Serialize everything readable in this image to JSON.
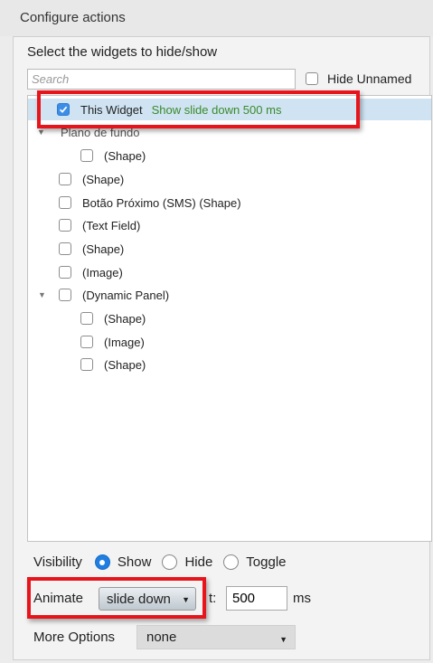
{
  "header": {
    "title": "Configure actions"
  },
  "selector": {
    "label": "Select the widgets to hide/show",
    "search_placeholder": "Search",
    "hide_unnamed_label": "Hide Unnamed"
  },
  "tree": {
    "selected": {
      "label": "This Widget",
      "action": "Show slide down 500 ms"
    },
    "group_label": "Plano de fundo",
    "items": [
      "(Shape)",
      "(Shape)",
      "Botão Próximo (SMS) (Shape)",
      "(Text Field)",
      "(Shape)",
      "(Image)",
      "(Dynamic Panel)",
      "(Shape)",
      "(Image)",
      "(Shape)"
    ]
  },
  "visibility": {
    "label": "Visibility",
    "options": [
      "Show",
      "Hide",
      "Toggle"
    ],
    "selected": "Show"
  },
  "animate": {
    "label": "Animate",
    "value": "slide down",
    "t_label": "t:",
    "duration": "500",
    "unit": "ms"
  },
  "more_options": {
    "label": "More Options",
    "value": "none"
  },
  "colors": {
    "accent": "#1f7ee0",
    "highlight_box": "#e8141c",
    "action_text": "#3a8a2a",
    "selected_row": "#cfe3f2"
  }
}
